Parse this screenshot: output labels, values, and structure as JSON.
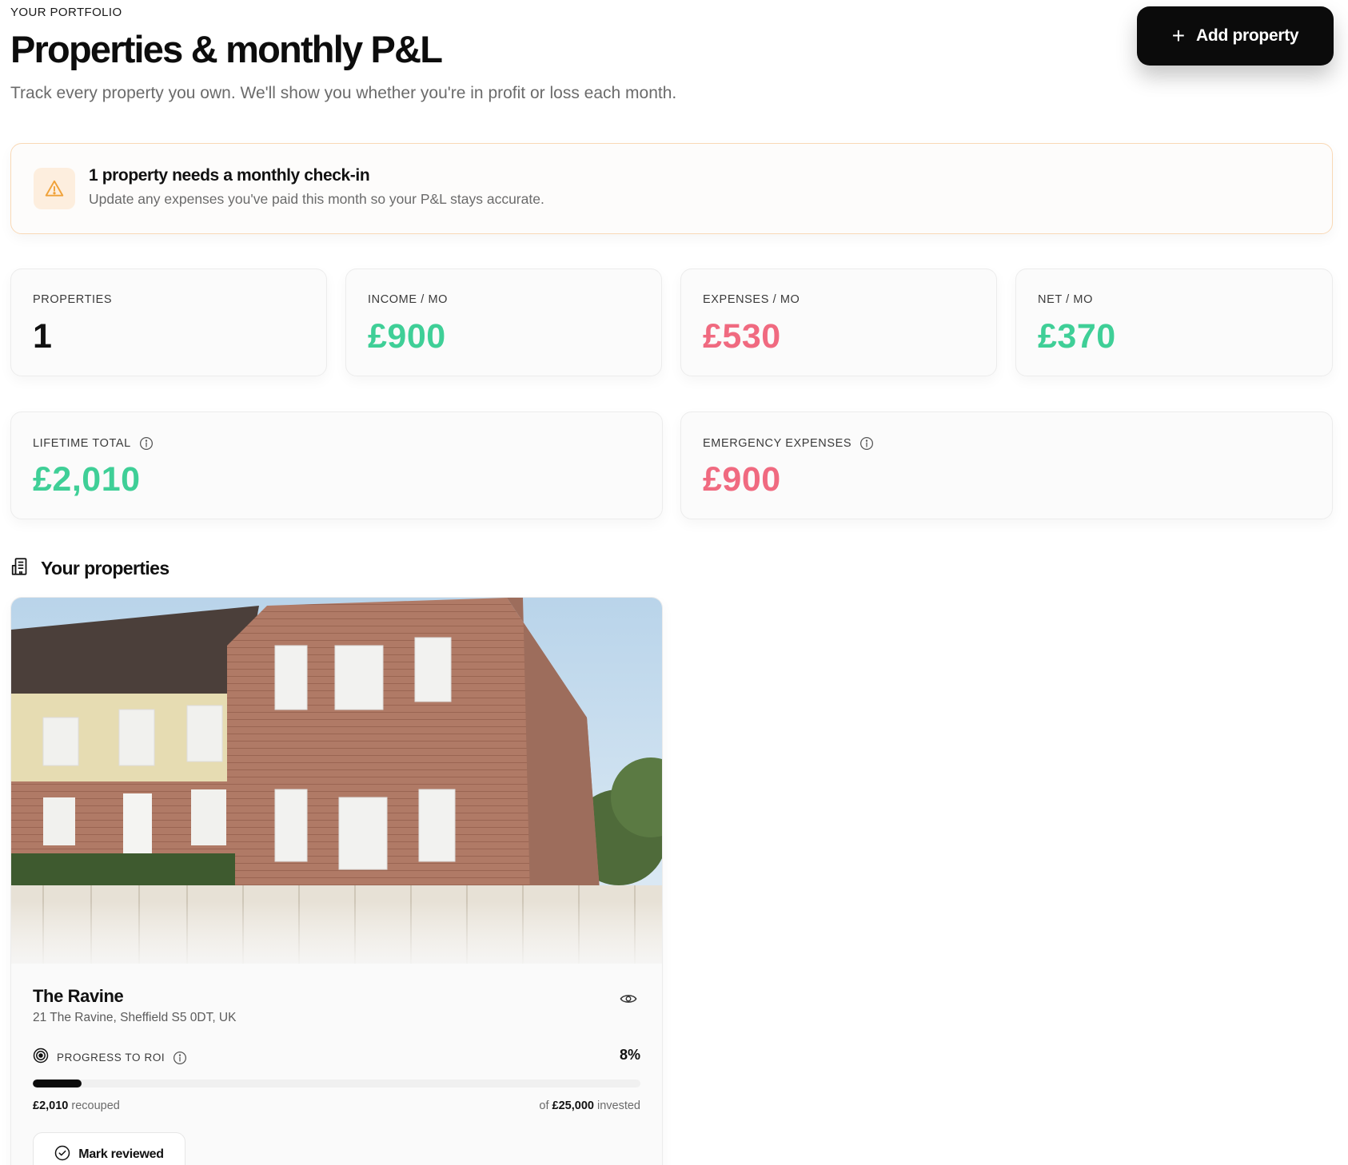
{
  "header": {
    "eyebrow": "YOUR PORTFOLIO",
    "title": "Properties & monthly P&L",
    "subtitle": "Track every property you own. We'll show you whether you're in profit or loss each month.",
    "add_button": "Add property"
  },
  "alert": {
    "title": "1 property needs a monthly check-in",
    "message": "Update any expenses you've paid this month so your P&L stays accurate."
  },
  "stats": {
    "properties": {
      "label": "PROPERTIES",
      "value": "1"
    },
    "income": {
      "label": "INCOME / MO",
      "value": "£900"
    },
    "expenses": {
      "label": "EXPENSES / MO",
      "value": "£530"
    },
    "net": {
      "label": "NET / MO",
      "value": "£370"
    },
    "lifetime": {
      "label": "LIFETIME TOTAL",
      "value": "£2,010"
    },
    "emergency": {
      "label": "EMERGENCY EXPENSES",
      "value": "£900"
    }
  },
  "colors": {
    "positive": "#3fcf97",
    "negative": "#f06a80",
    "warning": "#f0a23a"
  },
  "properties_section": {
    "title": "Your properties",
    "items": [
      {
        "name": "The Ravine",
        "address": "21 The Ravine, Sheffield S5 0DT, UK",
        "roi_label": "PROGRESS TO ROI",
        "roi_percent_text": "8%",
        "roi_progress": 0.08,
        "recouped_amount": "£2,010",
        "recouped_text": "recouped",
        "invested_prefix": "of",
        "invested_amount": "£25,000",
        "invested_text": "invested",
        "review_button": "Mark reviewed"
      }
    ]
  }
}
